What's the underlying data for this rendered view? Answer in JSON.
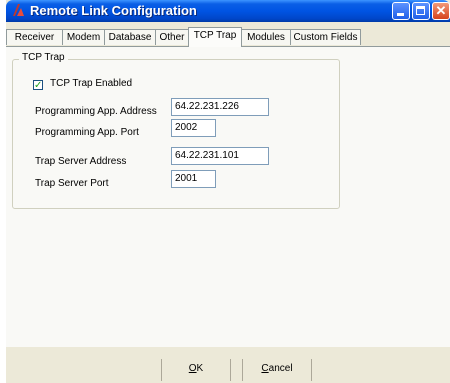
{
  "window": {
    "title": "Remote Link Configuration",
    "controls": {
      "minimize": "minimize",
      "maximize": "maximize",
      "close": "✕"
    }
  },
  "tabs": [
    {
      "label": "Receiver",
      "active": false
    },
    {
      "label": "Modem",
      "active": false
    },
    {
      "label": "Database",
      "active": false
    },
    {
      "label": "Other",
      "active": false
    },
    {
      "label": "TCP Trap",
      "active": true
    },
    {
      "label": "Modules",
      "active": false
    },
    {
      "label": "Custom Fields",
      "active": false
    }
  ],
  "group": {
    "legend": "TCP Trap",
    "checkbox_label": "TCP Trap Enabled",
    "checkbox_checked": true,
    "check_mark": "✓",
    "fields": {
      "programming_app_address": {
        "label": "Programming App. Address",
        "value": "64.22.231.226"
      },
      "programming_app_port": {
        "label": "Programming App. Port",
        "value": "2002"
      },
      "trap_server_address": {
        "label": "Trap Server Address",
        "value": "64.22.231.101"
      },
      "trap_server_port": {
        "label": "Trap Server Port",
        "value": "2001"
      }
    }
  },
  "buttons": {
    "ok": {
      "mnemonic": "O",
      "rest": "K"
    },
    "cancel": {
      "mnemonic": "C",
      "rest": "ancel"
    }
  }
}
